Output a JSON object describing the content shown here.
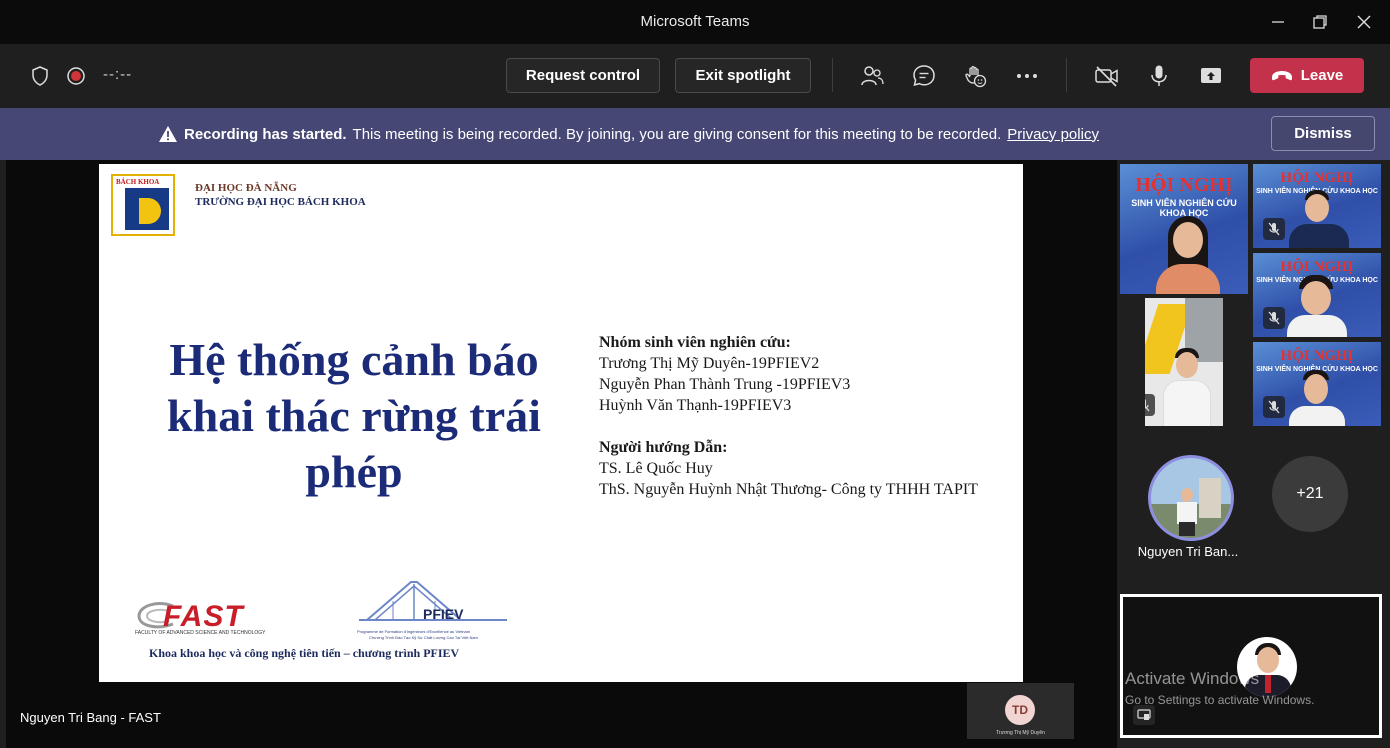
{
  "window": {
    "title": "Microsoft Teams"
  },
  "toolbar": {
    "timer": "--:--",
    "request_control": "Request control",
    "exit_spotlight": "Exit spotlight",
    "leave": "Leave"
  },
  "banner": {
    "bold": "Recording has started.",
    "message": "This meeting is being recorded. By joining, you are giving consent for this meeting to be recorded.",
    "link": "Privacy policy",
    "dismiss": "Dismiss"
  },
  "slide": {
    "logo_text": "BÁCH KHOA",
    "university": "ĐẠI HỌC ĐÀ NẴNG",
    "school": "TRƯỜNG ĐẠI HỌC BÁCH KHOA",
    "title_lines": [
      "Hệ thống cảnh báo",
      "khai thác rừng trái",
      "phép"
    ],
    "group_heading": "Nhóm sinh viên nghiên cứu:",
    "members": [
      "Trương Thị Mỹ Duyên-19PFIEV2",
      "Nguyễn Phan Thành Trung -19PFIEV3",
      "Huỳnh Văn Thạnh-19PFIEV3"
    ],
    "advisor_heading": "Người hướng Dẫn:",
    "advisors": [
      "TS. Lê Quốc Huy",
      "ThS. Nguyễn Huỳnh Nhật Thương- Công ty THHH TAPIT"
    ],
    "fast_logo": "FAST",
    "fast_sub": "FACULTY OF ADVANCED SCIENCE AND TECHNOLOGY",
    "pfiev_logo": "PFIEV",
    "pfiev_sub1": "Programme de Formation d'Ingénieurs d'Excellence au Vietnam",
    "pfiev_sub2": "Chương Trình Đào Tạo Kỹ Sư Chất Lượng Cao Tại Việt Nam",
    "footer": "Khoa khoa học và công nghệ tiên tiến – chương trình PFIEV"
  },
  "stage": {
    "speaker_name": "Nguyen Tri Bang - FAST",
    "td_initials": "TD",
    "td_name": "Trương Thị Mỹ Duyên"
  },
  "participants": {
    "poster_title": "HỘI NGHỊ",
    "poster_sub": "SINH VIÊN NGHIÊN CỨU KHOA HỌC",
    "spotlight_name": "Nguyen Tri Ban...",
    "more_count": "+21"
  },
  "self_view": {
    "activate_title": "Activate Windows",
    "activate_sub": "Go to Settings to activate Windows."
  }
}
